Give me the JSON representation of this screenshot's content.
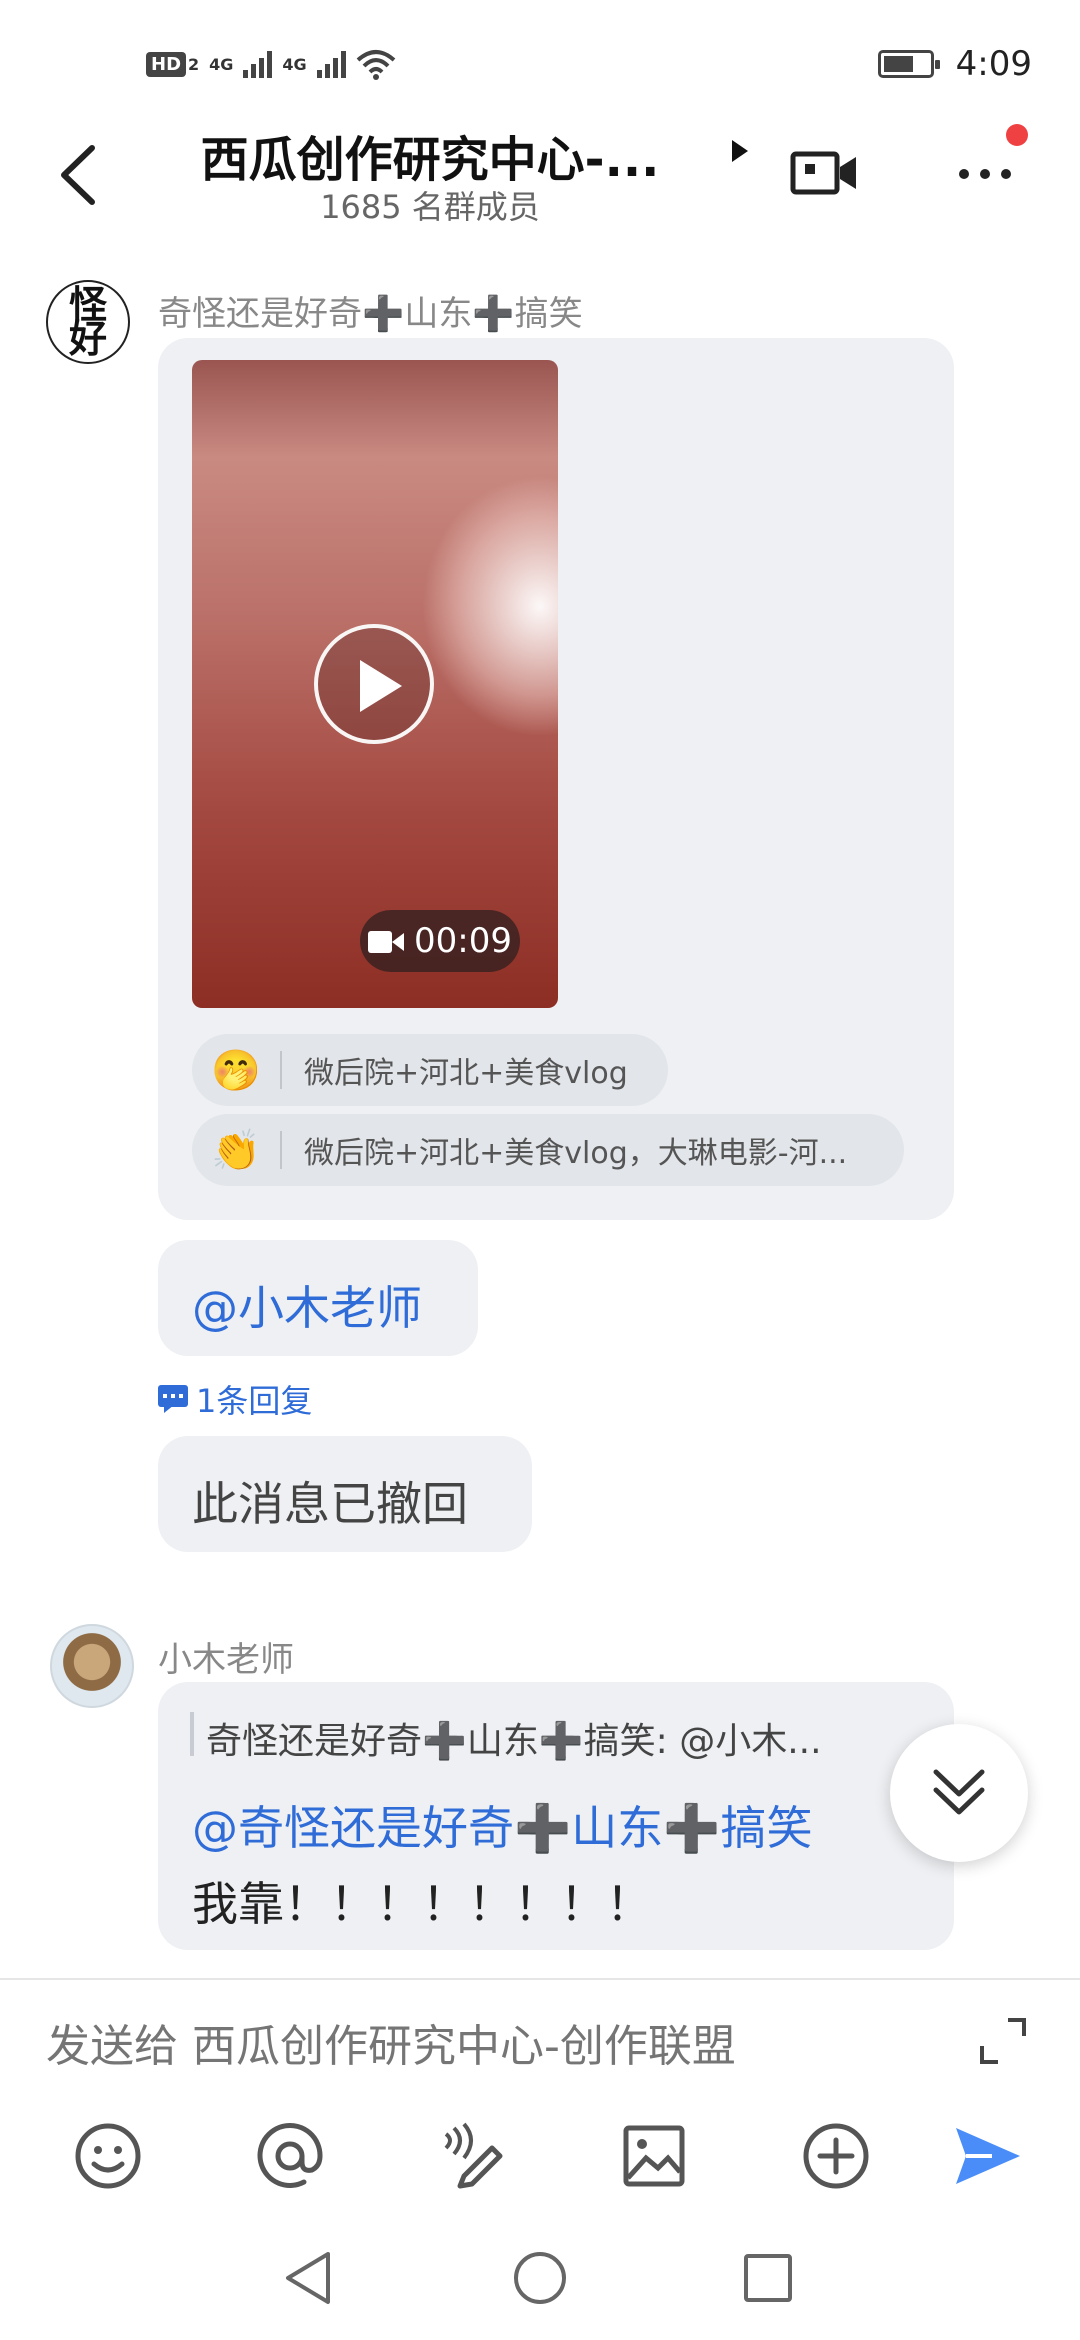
{
  "status_bar": {
    "hd": "HD",
    "sim1": "2",
    "net1": "4G",
    "net2": "4G",
    "time": "4:09"
  },
  "header": {
    "title": "西瓜创作研究中心-...",
    "member_count": "1685 名群成员"
  },
  "messages": [
    {
      "sender": "奇怪还是好奇➕山东➕搞笑",
      "avatar_text": "怪好",
      "video_duration": "00:09",
      "reactions": [
        {
          "emoji": "🤭",
          "users": "微后院+河北+美食vlog"
        },
        {
          "emoji": "👏",
          "users": "微后院+河北+美食vlog，大琳电影-河..."
        }
      ],
      "mention": "@小木老师",
      "reply_count": "1条回复",
      "recalled": "此消息已撤回"
    },
    {
      "sender": "小木老师",
      "quote": "奇怪还是好奇➕山东➕搞笑: @小木...",
      "mention": "@奇怪还是好奇➕山东➕搞笑",
      "text": "我靠！！！！！！！！"
    }
  ],
  "input": {
    "placeholder": "发送给 西瓜创作研究中心-创作联盟"
  },
  "colors": {
    "accent": "#2f6cd8",
    "send": "#4a8df8",
    "badge": "#f04142",
    "bubble": "#eef0f3"
  },
  "toolbar": [
    "emoji-icon",
    "at-icon",
    "voice-pen-icon",
    "image-icon",
    "plus-icon",
    "send-icon"
  ]
}
